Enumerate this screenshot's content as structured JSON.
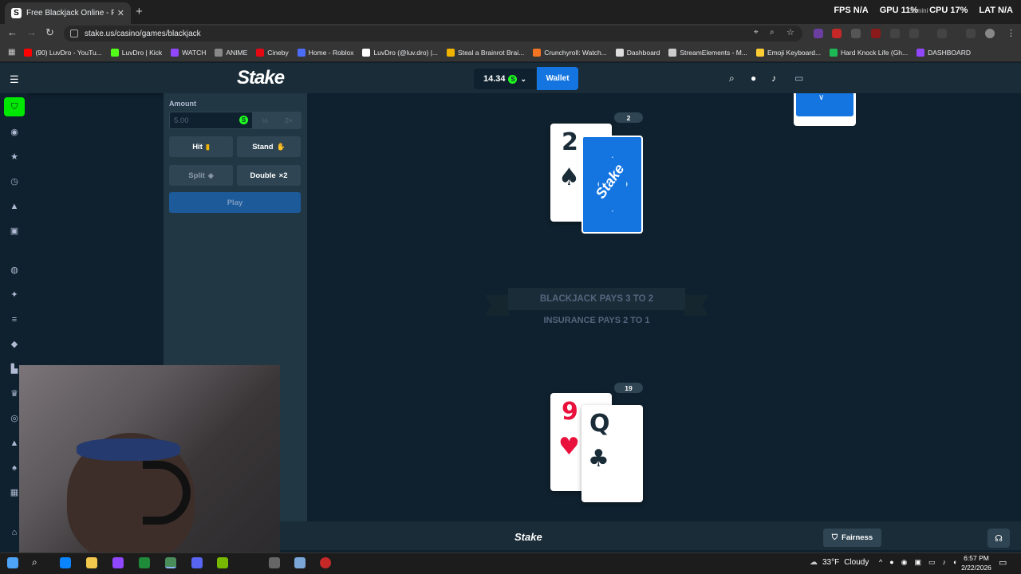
{
  "browser": {
    "tab_title": "Free Blackjack Online - Play Bla",
    "tab_favicon": "S",
    "url": "stake.us/casino/games/blackjack",
    "bookmarks": [
      {
        "label": "(90) LuvDro - YouTu...",
        "color": "#ff0000"
      },
      {
        "label": "LuvDro | Kick",
        "color": "#53fc18"
      },
      {
        "label": "WATCH",
        "color": "#9146ff"
      },
      {
        "label": "ANIME",
        "color": "#888888"
      },
      {
        "label": "Cineby",
        "color": "#e50914"
      },
      {
        "label": "Home - Roblox",
        "color": "#4a6cf7"
      },
      {
        "label": "LuvDro (@luv.dro) |...",
        "color": "#ffffff"
      },
      {
        "label": "Steal a Brainrot Brai...",
        "color": "#f0b400"
      },
      {
        "label": "Crunchyroll: Watch...",
        "color": "#f47521"
      },
      {
        "label": "Dashboard",
        "color": "#dddddd"
      },
      {
        "label": "StreamElements - M...",
        "color": "#cccccc"
      },
      {
        "label": "Emoji Keyboard...",
        "color": "#ffcc33"
      },
      {
        "label": "Hard Knock Life (Gh...",
        "color": "#1db954"
      },
      {
        "label": "DASHBOARD",
        "color": "#9146ff"
      }
    ]
  },
  "overlay": {
    "fps_label": "FPS",
    "fps_value": "N/A",
    "gpu_label": "GPU",
    "gpu_value": "11%",
    "cpu_label": "CPU",
    "cpu_value": "17%",
    "lat_label": "LAT",
    "lat_value": "N/A",
    "gemini": "Gemini"
  },
  "header": {
    "logo": "Stake",
    "balance": "14.34",
    "currency_icon": "S",
    "wallet_label": "Wallet"
  },
  "panel": {
    "amount_label": "Amount",
    "amount_value": "5.00",
    "half_label": "½",
    "double_label": "2×",
    "hit_label": "Hit",
    "stand_label": "Stand",
    "split_label": "Split",
    "double_btn_label": "Double",
    "double_btn_mult": "×2",
    "play_label": "Play"
  },
  "game": {
    "dealer_total": "2",
    "dealer_cards": [
      {
        "rank": "2",
        "suit": "♠"
      }
    ],
    "card_back_text": "Stake",
    "player_total": "19",
    "player_cards": [
      {
        "rank": "9",
        "suit": "♥"
      },
      {
        "rank": "Q",
        "suit": "♣"
      }
    ],
    "banner_line1": "BLACKJACK PAYS 3 TO 2",
    "banner_line2": "INSURANCE PAYS 2 TO 1"
  },
  "footer": {
    "logo": "Stake",
    "fairness_label": "Fairness"
  },
  "taskbar": {
    "weather": "33°F",
    "condition": "Cloudy",
    "time": "6:57 PM",
    "date": "2/22/2026"
  },
  "colors": {
    "background": "#0f212e",
    "panel": "#213743",
    "accent_blue": "#1475e1",
    "accent_green": "#00e701"
  }
}
